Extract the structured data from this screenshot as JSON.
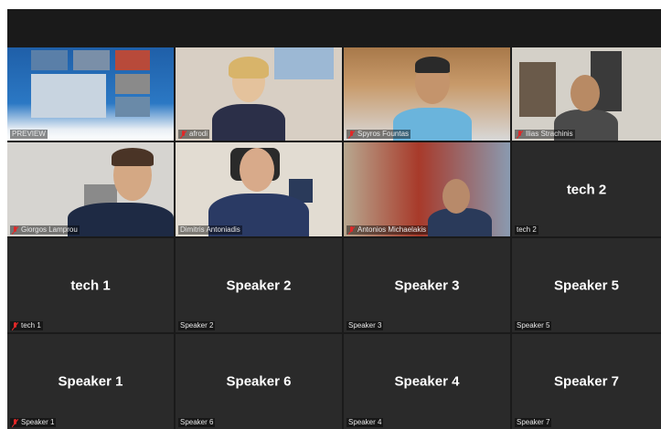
{
  "meeting": {
    "tiles": [
      {
        "id": "preview",
        "label": "PREVIEW",
        "muted": false,
        "big_name": ""
      },
      {
        "id": "afrodi",
        "label": "afrodi",
        "muted": true,
        "big_name": ""
      },
      {
        "id": "spyros",
        "label": "Spyros Fountas",
        "muted": true,
        "big_name": ""
      },
      {
        "id": "ilias",
        "label": "Ilias Strachinis",
        "muted": true,
        "big_name": ""
      },
      {
        "id": "giorgos",
        "label": "Giorgos Lamprou",
        "muted": true,
        "big_name": ""
      },
      {
        "id": "dimitris",
        "label": "Dimitris Antoniadis",
        "muted": false,
        "big_name": ""
      },
      {
        "id": "antonios",
        "label": "Antonios Michaelakis",
        "muted": true,
        "big_name": ""
      },
      {
        "id": "tech2",
        "label": "tech 2",
        "muted": false,
        "big_name": "tech 2"
      },
      {
        "id": "tech1",
        "label": "tech 1",
        "muted": true,
        "big_name": "tech 1"
      },
      {
        "id": "speaker2",
        "label": "Speaker 2",
        "muted": false,
        "big_name": "Speaker 2"
      },
      {
        "id": "speaker3",
        "label": "Speaker 3",
        "muted": false,
        "big_name": "Speaker 3"
      },
      {
        "id": "speaker5",
        "label": "Speaker 5",
        "muted": false,
        "big_name": "Speaker 5"
      },
      {
        "id": "speaker1",
        "label": "Speaker 1",
        "muted": true,
        "big_name": "Speaker 1"
      },
      {
        "id": "speaker6",
        "label": "Speaker 6",
        "muted": false,
        "big_name": "Speaker 6"
      },
      {
        "id": "speaker4",
        "label": "Speaker 4",
        "muted": false,
        "big_name": "Speaker 4"
      },
      {
        "id": "speaker7",
        "label": "Speaker 7",
        "muted": false,
        "big_name": "Speaker 7"
      }
    ],
    "active_speaker": "dimitris",
    "colors": {
      "stage_bg": "#1a1a1a",
      "tile_bg": "#2a2a2a",
      "active_outline": "#c8e35a",
      "muted_icon": "#e02828"
    }
  }
}
